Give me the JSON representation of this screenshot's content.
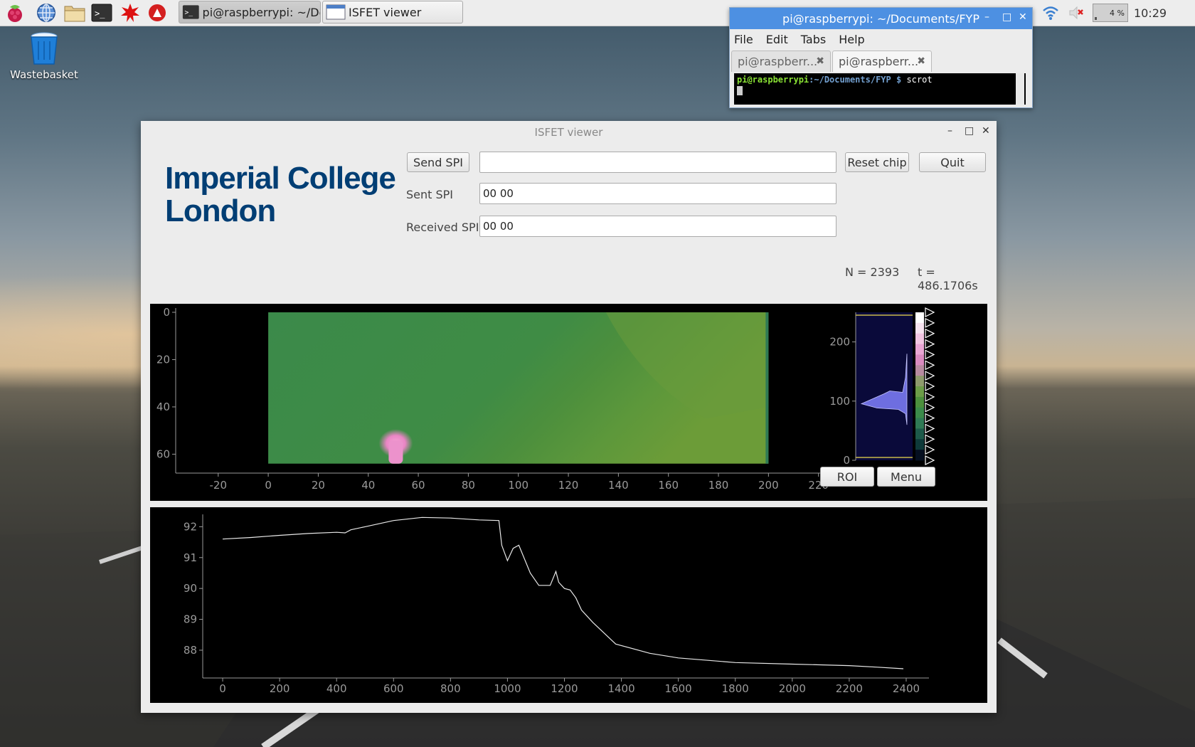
{
  "taskbar": {
    "tasks": [
      {
        "label": "pi@raspberrypi: ~/Do..."
      },
      {
        "label": "ISFET viewer"
      }
    ],
    "battery": "4 %",
    "clock": "10:29"
  },
  "desktop": {
    "icons": [
      {
        "label": "Wastebasket"
      }
    ]
  },
  "terminal": {
    "title": "pi@raspberrypi: ~/Documents/FYP",
    "menu": [
      "File",
      "Edit",
      "Tabs",
      "Help"
    ],
    "tabs": [
      {
        "label": "pi@raspberr..."
      },
      {
        "label": "pi@raspberr..."
      }
    ],
    "prompt_user": "pi@raspberrypi",
    "prompt_path": ":~/Documents/FYP $",
    "command": "scrot"
  },
  "isfet": {
    "title": "ISFET viewer",
    "logo_line1": "Imperial College",
    "logo_line2": "London",
    "send_spi_label": "Send SPI",
    "send_spi_value": "",
    "sent_spi_label": "Sent SPI",
    "sent_spi_value": "00 00",
    "received_spi_label": "Received SPI",
    "received_spi_value": "00 00",
    "reset_label": "Reset chip",
    "quit_label": "Quit",
    "n_text": "N = 2393",
    "t_text": "t = 486.1706s",
    "roi_label": "ROI",
    "menu_label": "Menu"
  },
  "chart_data": [
    {
      "type": "heatmap",
      "x_ticks": [
        "-20",
        "0",
        "20",
        "40",
        "60",
        "80",
        "100",
        "120",
        "140",
        "160",
        "180",
        "200",
        "220"
      ],
      "y_ticks": [
        "0",
        "20",
        "40",
        "60"
      ],
      "xlim": [
        -37,
        240
      ],
      "ylim": [
        0,
        68
      ],
      "image_extent": {
        "x": [
          0,
          200
        ],
        "y": [
          0,
          64
        ]
      },
      "colormap": "green with pink hotspot",
      "hotspot": {
        "x": 51,
        "y": 56
      }
    },
    {
      "type": "histogram",
      "y_ticks": [
        "0",
        "100",
        "200"
      ],
      "ylim": [
        0,
        250
      ],
      "peak_level": 110
    },
    {
      "type": "line",
      "x_ticks": [
        "0",
        "200",
        "400",
        "600",
        "800",
        "1000",
        "1200",
        "1400",
        "1600",
        "1800",
        "2000",
        "2200",
        "2400"
      ],
      "y_ticks": [
        "88",
        "89",
        "90",
        "91",
        "92"
      ],
      "xlim": [
        -70,
        2480
      ],
      "ylim": [
        87.1,
        92.4
      ],
      "x": [
        0,
        100,
        200,
        300,
        400,
        430,
        450,
        500,
        600,
        700,
        800,
        900,
        970,
        980,
        1000,
        1020,
        1040,
        1080,
        1110,
        1150,
        1170,
        1180,
        1200,
        1220,
        1240,
        1260,
        1300,
        1380,
        1500,
        1600,
        1800,
        2000,
        2200,
        2300,
        2390
      ],
      "y": [
        91.6,
        91.65,
        91.72,
        91.78,
        91.82,
        91.8,
        91.9,
        92.0,
        92.2,
        92.3,
        92.28,
        92.22,
        92.2,
        91.4,
        90.9,
        91.3,
        91.4,
        90.5,
        90.1,
        90.1,
        90.55,
        90.2,
        90.0,
        89.95,
        89.7,
        89.3,
        88.9,
        88.2,
        87.9,
        87.75,
        87.6,
        87.55,
        87.5,
        87.45,
        87.4
      ]
    }
  ]
}
